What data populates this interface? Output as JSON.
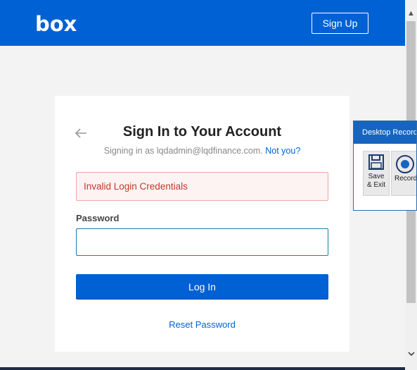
{
  "header": {
    "logo_text": "box",
    "signup_label": "Sign Up"
  },
  "login": {
    "title": "Sign In to Your Account",
    "signing_prefix": "Signing in as lqdadmin@lqdfinance.com.",
    "not_you": "Not you?",
    "error": "Invalid Login Credentials",
    "password_label": "Password",
    "password_value": "",
    "login_label": "Log In",
    "reset_label": "Reset Password"
  },
  "recorder": {
    "title": "Desktop Recorder",
    "save_label_line1": "Save",
    "save_label_line2": "& Exit",
    "record_label": "Record"
  },
  "colors": {
    "brand": "#0061d5",
    "error_text": "#c0392b",
    "error_bg": "#fdf3f3"
  }
}
